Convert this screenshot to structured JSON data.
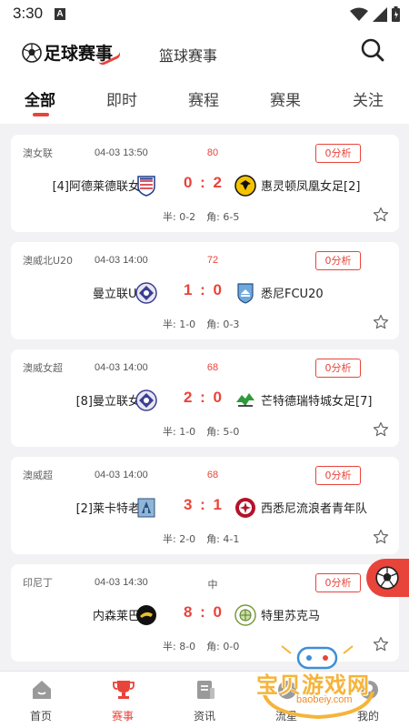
{
  "status_bar": {
    "time": "3:30",
    "notification_letter": "A"
  },
  "header": {
    "title": "足球赛事",
    "basketball_tab": "篮球赛事"
  },
  "subtabs": [
    {
      "label": "全部",
      "active": true
    },
    {
      "label": "即时",
      "active": false
    },
    {
      "label": "赛程",
      "active": false
    },
    {
      "label": "赛果",
      "active": false
    },
    {
      "label": "关注",
      "active": false
    }
  ],
  "matches": [
    {
      "league": "澳女联",
      "time": "04-03 13:50",
      "minute": "80",
      "analysis": "0分析",
      "home": "[4]阿德莱德联女足",
      "home_logo": "adelaide-logo",
      "score": "0 : 2",
      "away": "惠灵顿凤凰女足[2]",
      "away_logo": "wellington-logo",
      "half": "半: 0-2",
      "corner": "角: 6-5"
    },
    {
      "league": "澳威北U20",
      "time": "04-03 14:00",
      "minute": "72",
      "analysis": "0分析",
      "home": "曼立联U20",
      "home_logo": "manly-logo",
      "score": "1 : 0",
      "away": "悉尼FCU20",
      "away_logo": "sydneyfc-logo",
      "half": "半: 1-0",
      "corner": "角: 0-3"
    },
    {
      "league": "澳威女超",
      "time": "04-03 14:00",
      "minute": "68",
      "analysis": "0分析",
      "home": "[8]曼立联女足",
      "home_logo": "manly-logo",
      "score": "2 : 0",
      "away": "芒特德瑞特城女足[7]",
      "away_logo": "mtdruitt-logo",
      "half": "半: 1-0",
      "corner": "角: 5-0"
    },
    {
      "league": "澳威超",
      "time": "04-03 14:00",
      "minute": "68",
      "analysis": "0分析",
      "home": "[2]莱卡特老虎",
      "home_logo": "rockdale-logo",
      "score": "3 : 1",
      "away": "西悉尼流浪者青年队",
      "away_logo": "wanderers-logo",
      "half": "半: 2-0",
      "corner": "角: 4-1"
    },
    {
      "league": "印尼丁",
      "time": "04-03 14:30",
      "minute": "中",
      "analysis": "0分析",
      "home": "内森莱巴克",
      "home_logo": "black-logo",
      "score": "8 : 0",
      "away": "特里苏克马",
      "away_logo": "green-logo",
      "half": "半: 8-0",
      "corner": "角: 0-0"
    }
  ],
  "bottom_nav": [
    {
      "label": "首页",
      "icon": "home-icon",
      "active": false
    },
    {
      "label": "赛事",
      "icon": "trophy-icon",
      "active": true
    },
    {
      "label": "资讯",
      "icon": "news-icon",
      "active": false
    },
    {
      "label": "流星",
      "icon": "star-nav-icon",
      "active": false
    },
    {
      "label": "我的",
      "icon": "profile-icon",
      "active": false
    }
  ],
  "watermark": {
    "text": "宝贝游戏网",
    "url": "baobeiy.com"
  },
  "colors": {
    "accent": "#e8443a",
    "background": "#f2f2f4"
  }
}
